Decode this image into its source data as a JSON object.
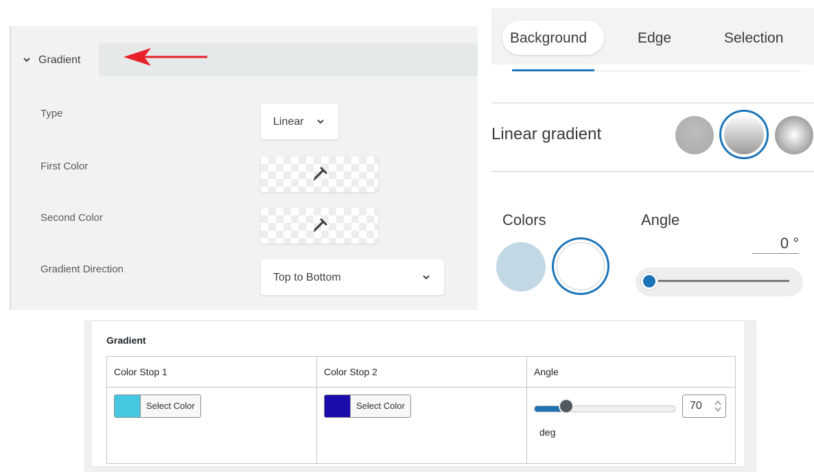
{
  "panel_a": {
    "section_title": "Gradient",
    "fields": {
      "type_label": "Type",
      "type_value": "Linear",
      "first_color_label": "First Color",
      "second_color_label": "Second Color",
      "direction_label": "Gradient Direction",
      "direction_value": "Top to Bottom"
    },
    "colors": {
      "arrow": "#e8202a"
    },
    "icons": [
      "chevron-down-icon",
      "eyedropper-icon",
      "arrow-left-icon"
    ]
  },
  "panel_b": {
    "tabs": [
      {
        "label": "Background",
        "active": true
      },
      {
        "label": "Edge",
        "active": false
      },
      {
        "label": "Selection",
        "active": false
      }
    ],
    "gradient_title": "Linear gradient",
    "gradient_styles_selected": 1,
    "colors_label": "Colors",
    "angle_label": "Angle",
    "angle_value": "0 °",
    "angle_slider_fraction": 0,
    "color_swatches": [
      "#c3d8e5",
      "#ffffff"
    ],
    "accent": "#1b74b8"
  },
  "panel_c": {
    "title": "Gradient",
    "columns": [
      "Color Stop 1",
      "Color Stop 2",
      "Angle"
    ],
    "color_stop_1": {
      "button_label": "Select Color",
      "color": "#44c7e0"
    },
    "color_stop_2": {
      "button_label": "Select Color",
      "color": "#1a0dab"
    },
    "angle": {
      "value": "70",
      "unit": "deg",
      "slider_fraction": 0.19
    },
    "accent": "#2271b1"
  }
}
